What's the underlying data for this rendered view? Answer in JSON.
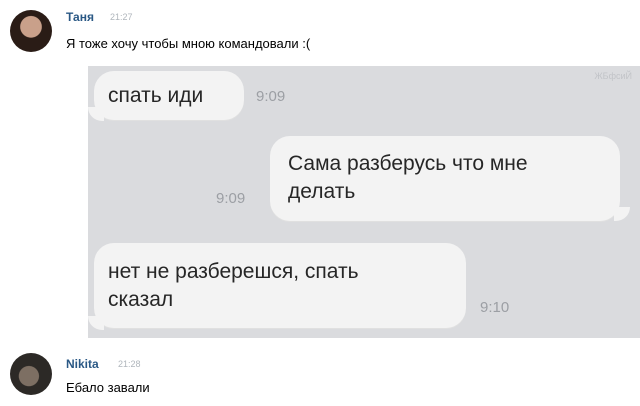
{
  "messages": [
    {
      "author": "Таня",
      "time": "21:27",
      "text": "Я тоже хочу чтобы мною командовали :(",
      "attachment": {
        "corner_text": "ЖБфсиЙ",
        "bubbles": [
          {
            "side": "incoming",
            "text_lines": [
              "спать иди"
            ],
            "time": "9:09"
          },
          {
            "side": "outgoing",
            "text_lines": [
              "Сама разберусь что мне",
              "делать"
            ],
            "time": "9:09"
          },
          {
            "side": "incoming",
            "text_lines": [
              "нет не разберешся, спать",
              "сказал"
            ],
            "time": "9:10"
          }
        ],
        "colors": {
          "background": "#dadbde",
          "bubble": "#f3f3f3",
          "text": "#262626",
          "time": "#9c9fa4"
        }
      }
    },
    {
      "author": "Nikita",
      "time": "21:28",
      "text": "Ебало завали"
    }
  ],
  "colors": {
    "author": "#2a5885",
    "timestamp": "#b0b6bc",
    "text": "#000000"
  },
  "icons": {
    "avatar_tanya": "user-photo",
    "avatar_nikita": "user-photo"
  }
}
